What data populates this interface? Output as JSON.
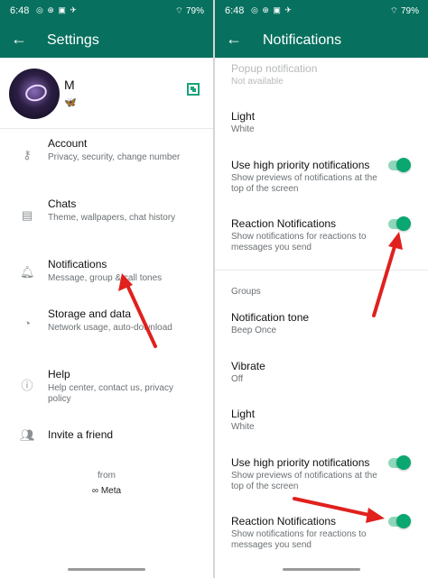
{
  "status": {
    "time": "6:48",
    "battery": "79%"
  },
  "left": {
    "appbar_title": "Settings",
    "profile": {
      "name": "M",
      "emoji": "🦋"
    },
    "items": [
      {
        "title": "Account",
        "subtitle": "Privacy, security, change number",
        "icon": "key-icon"
      },
      {
        "title": "Chats",
        "subtitle": "Theme, wallpapers, chat history",
        "icon": "chat-icon"
      },
      {
        "title": "Notifications",
        "subtitle": "Message, group & call tones",
        "icon": "bell-icon"
      },
      {
        "title": "Storage and data",
        "subtitle": "Network usage, auto-download",
        "icon": "storage-icon"
      },
      {
        "title": "Help",
        "subtitle": "Help center, contact us, privacy policy",
        "icon": "help-icon"
      },
      {
        "title": "Invite a friend",
        "subtitle": "",
        "icon": "people-icon"
      }
    ],
    "footer": {
      "from": "from",
      "brand": "∞ Meta"
    }
  },
  "right": {
    "appbar_title": "Notifications",
    "popup": {
      "title": "Popup notification",
      "subtitle": "Not available"
    },
    "message_light": {
      "title": "Light",
      "subtitle": "White"
    },
    "message_high_priority": {
      "title": "Use high priority notifications",
      "subtitle": "Show previews of notifications at the top of the screen",
      "on": true
    },
    "message_reaction": {
      "title": "Reaction Notifications",
      "subtitle": "Show notifications for reactions to messages you send",
      "on": true
    },
    "groups_header": "Groups",
    "group_tone": {
      "title": "Notification tone",
      "subtitle": "Beep Once"
    },
    "group_vibrate": {
      "title": "Vibrate",
      "subtitle": "Off"
    },
    "group_light": {
      "title": "Light",
      "subtitle": "White"
    },
    "group_high_priority": {
      "title": "Use high priority notifications",
      "subtitle": "Show previews of notifications at the top of the screen",
      "on": true
    },
    "group_reaction": {
      "title": "Reaction Notifications",
      "subtitle": "Show notifications for reactions to messages you send",
      "on": true
    }
  },
  "colors": {
    "appbar": "#07705e",
    "toggle_on": "#0aa771",
    "arrow": "#e0211d"
  }
}
